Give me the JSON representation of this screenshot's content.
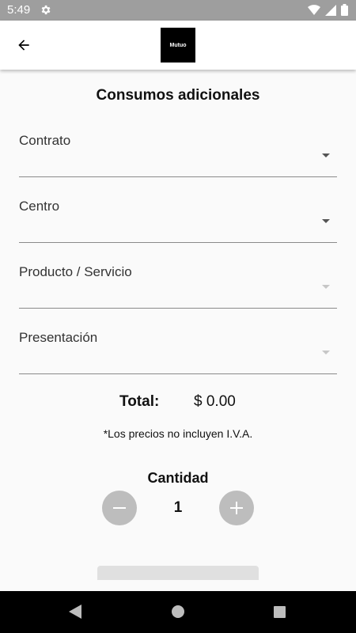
{
  "status_bar": {
    "time": "5:49",
    "icons": [
      "gear-icon",
      "wifi-icon",
      "signal-icon",
      "battery-icon"
    ]
  },
  "app_bar": {
    "back_icon": "arrow-left-icon",
    "logo_text": "Mutuo"
  },
  "page": {
    "title": "Consumos adicionales"
  },
  "form": {
    "fields": [
      {
        "label": "Contrato",
        "value": "",
        "enabled": true
      },
      {
        "label": "Centro",
        "value": "",
        "enabled": true
      },
      {
        "label": "Producto / Servicio",
        "value": "",
        "enabled": false
      },
      {
        "label": "Presentación",
        "value": "",
        "enabled": false
      }
    ]
  },
  "total": {
    "label": "Total:",
    "value": "$ 0.00"
  },
  "note": "*Los precios no incluyen I.V.A.",
  "quantity": {
    "label": "Cantidad",
    "value": "1"
  },
  "colors": {
    "status_bar": "#9e9e9e",
    "qty_button": "#bdbdbd",
    "background": "#fafafa"
  },
  "nav_bar": {
    "icons": [
      "nav-back-icon",
      "nav-home-icon",
      "nav-recents-icon"
    ]
  }
}
